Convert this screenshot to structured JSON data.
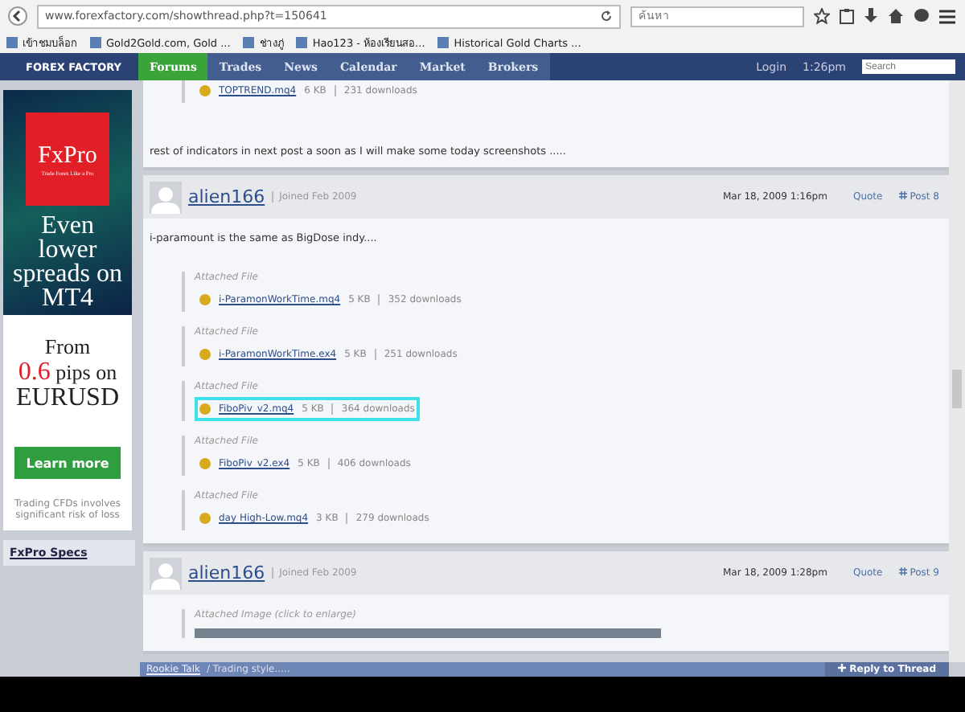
{
  "browser": {
    "url": "www.forexfactory.com/showthread.php?t=150641",
    "search_placeholder": "ค้นหา",
    "bookmarks": [
      {
        "label": "เข้าชมบล็อก"
      },
      {
        "label": "Gold2Gold.com, Gold ..."
      },
      {
        "label": "ช่างภู่"
      },
      {
        "label": "Hao123 - ห้องเรียนสอ..."
      },
      {
        "label": "Historical Gold Charts ..."
      }
    ]
  },
  "site_nav": {
    "logo": "FOREX FACTORY",
    "tabs": [
      {
        "label": "Forums",
        "selected": true
      },
      {
        "label": "Trades",
        "selected": false
      },
      {
        "label": "News",
        "selected": false
      },
      {
        "label": "Calendar",
        "selected": false
      },
      {
        "label": "Market",
        "selected": false
      },
      {
        "label": "Brokers",
        "selected": false
      }
    ],
    "login": "Login",
    "time": "1:26pm",
    "search_placeholder": "Search"
  },
  "ad": {
    "brand": "FxPro",
    "tagline": "Trade Forex Like a Pro",
    "headline": "Even lower spreads on MT4",
    "from": "From",
    "rate": "0.6",
    "rate_rest": "pips on",
    "pair": "EURUSD",
    "button": "Learn more",
    "disclaimer": "Trading CFDs involves significant risk of loss",
    "specs_link": "FxPro Specs"
  },
  "top_post": {
    "attachment": {
      "name": "TOPTREND.mq4",
      "size": "6 KB",
      "downloads": "231 downloads"
    },
    "text": "rest of indicators in next post a soon as I will make some today screenshots ....."
  },
  "post": {
    "user": "alien166",
    "joined": "Joined Feb 2009",
    "date": "Mar 18, 2009 1:16pm",
    "quote": "Quote",
    "number": "Post 8",
    "text": "i-paramount is the same as BigDose indy....",
    "attachments": [
      {
        "label": "Attached File",
        "name": "i-ParamonWorkTime.mq4",
        "size": "5 KB",
        "downloads": "352 downloads",
        "highlighted": false
      },
      {
        "label": "Attached File",
        "name": "i-ParamonWorkTime.ex4",
        "size": "5 KB",
        "downloads": "251 downloads",
        "highlighted": false
      },
      {
        "label": "Attached File",
        "name": "FiboPiv_v2.mq4",
        "size": "5 KB",
        "downloads": "364 downloads",
        "highlighted": true
      },
      {
        "label": "Attached File",
        "name": "FiboPiv_v2.ex4",
        "size": "5 KB",
        "downloads": "406 downloads",
        "highlighted": false
      },
      {
        "label": "Attached File",
        "name": "day High-Low.mq4",
        "size": "3 KB",
        "downloads": "279 downloads",
        "highlighted": false
      }
    ]
  },
  "next_post": {
    "user": "alien166",
    "joined": "Joined Feb 2009",
    "date": "Mar 18, 2009 1:28pm",
    "quote": "Quote",
    "number": "Post 9",
    "image_label": "Attached Image (click to enlarge)"
  },
  "footer": {
    "crumb": "Rookie Talk",
    "current": "/ Trading style.....",
    "reply": "Reply to Thread"
  }
}
